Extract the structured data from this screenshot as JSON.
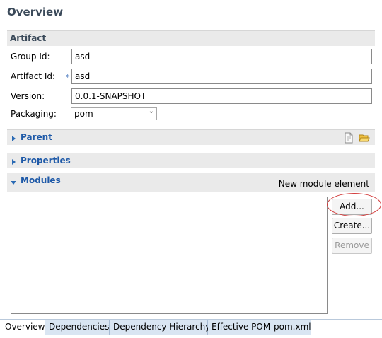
{
  "page": {
    "title": "Overview"
  },
  "artifact": {
    "header": "Artifact",
    "fields": [
      {
        "label": "Group Id:",
        "value": "asd"
      },
      {
        "label": "Artifact Id:",
        "value": "asd",
        "required_mark": "*"
      },
      {
        "label": "Version:",
        "value": "0.0.1-SNAPSHOT"
      }
    ],
    "packaging": {
      "label": "Packaging:",
      "value": "pom"
    }
  },
  "parent": {
    "header": "Parent",
    "icons": [
      "new-file-icon",
      "open-folder-icon"
    ]
  },
  "properties": {
    "header": "Properties"
  },
  "modules": {
    "header": "Modules",
    "hint": "New module element",
    "items": [],
    "buttons": {
      "add": "Add...",
      "create": "Create...",
      "remove": "Remove"
    }
  },
  "tabs": [
    "Overview",
    "Dependencies",
    "Dependency Hierarchy",
    "Effective POM",
    "pom.xml"
  ],
  "active_tab": "Overview",
  "colors": {
    "section_title": "#3b4a5a",
    "section_bg": "#eaeaea",
    "twisty": "#2a6ab4",
    "highlight": "#d23b3b",
    "tab_bg": "#d9e5f2"
  }
}
